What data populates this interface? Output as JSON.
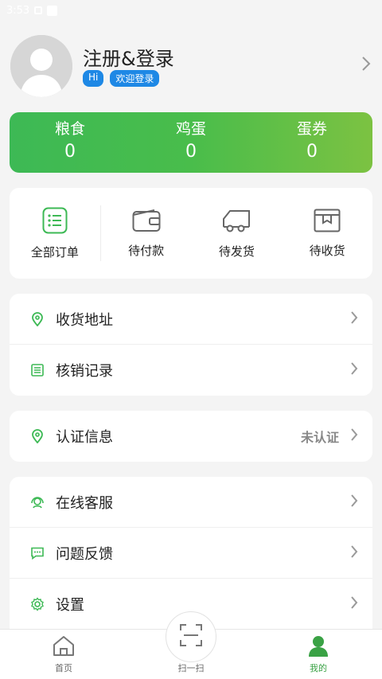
{
  "status_bar": {
    "time": "3:53"
  },
  "profile": {
    "name": "注册&登录",
    "tag_hi": "Hi",
    "tag_welcome": "欢迎登录"
  },
  "assets": [
    {
      "label": "粮食",
      "value": "0"
    },
    {
      "label": "鸡蛋",
      "value": "0"
    },
    {
      "label": "蛋券",
      "value": "0"
    }
  ],
  "orders": [
    {
      "label": "全部订单",
      "icon": "list-icon"
    },
    {
      "label": "待付款",
      "icon": "wallet-icon"
    },
    {
      "label": "待发货",
      "icon": "truck-icon"
    },
    {
      "label": "待收货",
      "icon": "box-icon"
    }
  ],
  "menu_group1": [
    {
      "label": "收货地址",
      "icon": "location-icon"
    },
    {
      "label": "核销记录",
      "icon": "record-icon"
    }
  ],
  "menu_group2": [
    {
      "label": "认证信息",
      "icon": "location-icon",
      "value": "未认证"
    }
  ],
  "menu_group3": [
    {
      "label": "在线客服",
      "icon": "headset-icon"
    },
    {
      "label": "问题反馈",
      "icon": "feedback-icon"
    },
    {
      "label": "设置",
      "icon": "gear-icon"
    }
  ],
  "tabbar": {
    "home": "首页",
    "scan": "扫一扫",
    "mine": "我的"
  },
  "colors": {
    "brand_green": "#3db955",
    "tag_blue": "#1e88e5",
    "active_tab": "#3aa245"
  }
}
